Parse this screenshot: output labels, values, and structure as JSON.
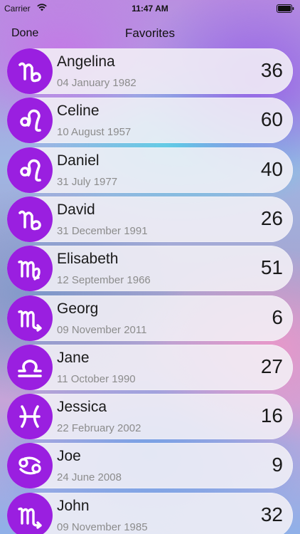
{
  "status_bar": {
    "carrier": "Carrier",
    "time": "11:47 AM"
  },
  "nav": {
    "done_label": "Done",
    "title": "Favorites"
  },
  "accent_color": "#9a1fe0",
  "favorites": [
    {
      "name": "Angelina",
      "date": "04 January 1982",
      "age": "36",
      "sign_icon": "capricorn-icon"
    },
    {
      "name": "Celine",
      "date": "10 August 1957",
      "age": "60",
      "sign_icon": "leo-icon"
    },
    {
      "name": "Daniel",
      "date": "31 July 1977",
      "age": "40",
      "sign_icon": "leo-icon"
    },
    {
      "name": "David",
      "date": "31 December 1991",
      "age": "26",
      "sign_icon": "capricorn-icon"
    },
    {
      "name": "Elisabeth",
      "date": "12 September 1966",
      "age": "51",
      "sign_icon": "virgo-icon"
    },
    {
      "name": "Georg",
      "date": "09 November 2011",
      "age": "6",
      "sign_icon": "scorpio-icon"
    },
    {
      "name": "Jane",
      "date": "11 October 1990",
      "age": "27",
      "sign_icon": "libra-icon"
    },
    {
      "name": "Jessica",
      "date": "22 February 2002",
      "age": "16",
      "sign_icon": "pisces-icon"
    },
    {
      "name": "Joe",
      "date": "24 June 2008",
      "age": "9",
      "sign_icon": "cancer-icon"
    },
    {
      "name": "John",
      "date": "09 November 1985",
      "age": "32",
      "sign_icon": "scorpio-icon"
    }
  ]
}
